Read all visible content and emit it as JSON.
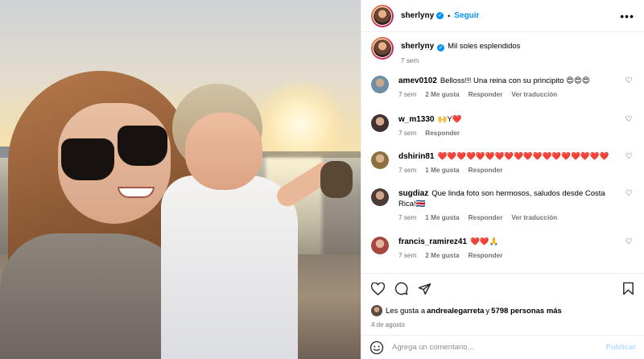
{
  "post": {
    "username": "sherlyny",
    "separator": "•",
    "follow_label": "Seguir",
    "more_label": "•••",
    "caption": "Mil soles esplendidos",
    "caption_age": "7 sem"
  },
  "comments": [
    {
      "username": "amev0102",
      "text": "Belloss!!! Una reina con su principito 😍😍😍",
      "age": "7 sem",
      "likes": "2 Me gusta",
      "reply": "Responder",
      "translate": "Ver traducción",
      "avatar_color": "#6f8fa6"
    },
    {
      "username": "w_m1330",
      "text": "🙌Y❤️",
      "age": "7 sem",
      "likes": "",
      "reply": "Responder",
      "translate": "",
      "avatar_color": "#3e3330"
    },
    {
      "username": "dshirin81",
      "text": "❤️❤️❤️❤️❤️❤️❤️❤️❤️❤️❤️❤️❤️❤️❤️❤️❤️❤️",
      "age": "7 sem",
      "likes": "1 Me gusta",
      "reply": "Responder",
      "translate": "",
      "avatar_color": "#8c6f3e"
    },
    {
      "username": "sugdiaz",
      "text": "Que linda foto son hermosos, saludos desde Costa Rica!🇨🇷",
      "age": "7 sem",
      "likes": "1 Me gusta",
      "reply": "Responder",
      "translate": "Ver traducción",
      "avatar_color": "#4b3b34"
    },
    {
      "username": "francis_ramirez41",
      "text": "❤️❤️🙏",
      "age": "7 sem",
      "likes": "2 Me gusta",
      "reply": "Responder",
      "translate": "",
      "avatar_color": "#a8473f"
    }
  ],
  "likes_summary": {
    "prefix": "Les gusta a ",
    "user": "andrealegarreta",
    "middle": " y ",
    "count": "5798 personas más"
  },
  "date": "4 de agosto",
  "composer": {
    "placeholder": "Agrega un comentario...",
    "publish_label": "Publicar"
  },
  "icons": [
    "heart-icon",
    "comment-icon",
    "share-icon",
    "bookmark-icon",
    "emoji-icon",
    "verified-badge-icon",
    "more-options-icon"
  ]
}
